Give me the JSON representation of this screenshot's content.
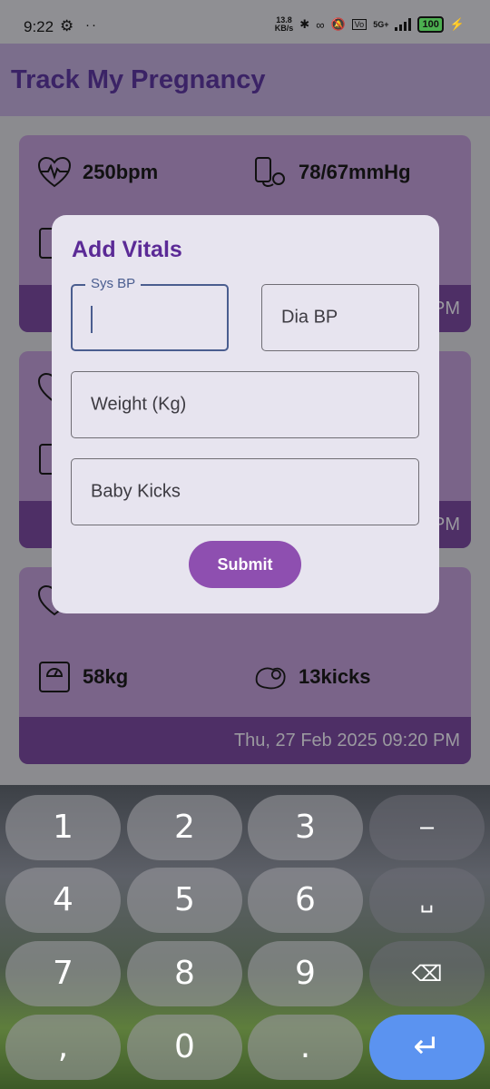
{
  "status": {
    "time": "9:22",
    "net_speed_value": "13.8",
    "net_speed_unit": "KB/s",
    "network": "5G+",
    "battery": "100"
  },
  "app": {
    "title": "Track My Pregnancy"
  },
  "cards": [
    {
      "heart_rate": "250bpm",
      "bp": "78/67mmHg",
      "date": "PM"
    },
    {
      "date": "PM"
    },
    {
      "weight": "58kg",
      "kicks": "13kicks",
      "date": "Thu, 27 Feb 2025 09:20 PM"
    }
  ],
  "dialog": {
    "title": "Add Vitals",
    "sys_bp_label": "Sys BP",
    "dia_bp_placeholder": "Dia BP",
    "weight_placeholder": "Weight (Kg)",
    "kicks_placeholder": "Baby Kicks",
    "submit_label": "Submit"
  },
  "keyboard": {
    "keys": [
      "1",
      "2",
      "3",
      "4",
      "5",
      "6",
      "7",
      "8",
      "9",
      ",",
      "0",
      "."
    ],
    "minus": "−",
    "space": "␣",
    "backspace": "⌫",
    "enter": "↵"
  },
  "colors": {
    "primary": "#5b2a96",
    "submit": "#8e4fb0",
    "enter_key": "#5b93f0"
  }
}
